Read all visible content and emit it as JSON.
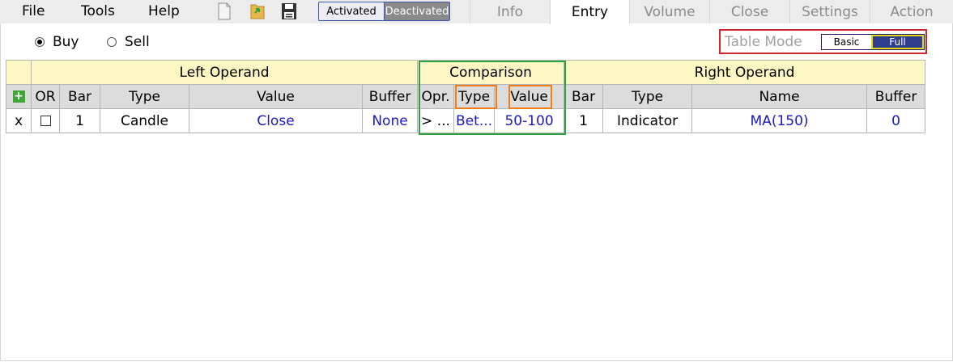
{
  "menu": {
    "file": "File",
    "tools": "Tools",
    "help": "Help"
  },
  "toolbar": {
    "icons": [
      "new-document-icon",
      "open-folder-icon",
      "save-disk-icon"
    ]
  },
  "activation_toggle": {
    "activated": "Activated",
    "deactivated": "Deactivated"
  },
  "tabs": [
    "Info",
    "Entry",
    "Volume",
    "Close",
    "Settings",
    "Action"
  ],
  "active_tab": "Entry",
  "side": {
    "buy": "Buy",
    "sell": "Sell",
    "selected": "Buy"
  },
  "table_mode": {
    "label": "Table Mode",
    "basic": "Basic",
    "full": "Full",
    "selected": "Full"
  },
  "table": {
    "groups": {
      "left": "Left Operand",
      "comparison": "Comparison",
      "right": "Right Operand"
    },
    "columns": {
      "or": "OR",
      "bar": "Bar",
      "type": "Type",
      "value": "Value",
      "buffer": "Buffer",
      "opr": "Opr.",
      "cmp_type": "Type",
      "cmp_value": "Value",
      "r_bar": "Bar",
      "r_type": "Type",
      "r_name": "Name",
      "r_buffer": "Buffer"
    },
    "rows": [
      {
        "delete": "x",
        "or_checked": false,
        "bar": "1",
        "type": "Candle",
        "value": "Close",
        "buffer": "None",
        "opr": "> ...",
        "cmp_type": "Bet...",
        "cmp_value": "50-100",
        "r_bar": "1",
        "r_type": "Indicator",
        "r_name": "MA(150)",
        "r_buffer": "0"
      }
    ]
  },
  "colors": {
    "link_blue": "#1a1ab8",
    "header_yellow": "#fdf7c4",
    "header_gray": "#dcdcdc",
    "highlight_red": "#d0262c",
    "highlight_green": "#2ea043",
    "highlight_orange": "#f07c1c"
  }
}
